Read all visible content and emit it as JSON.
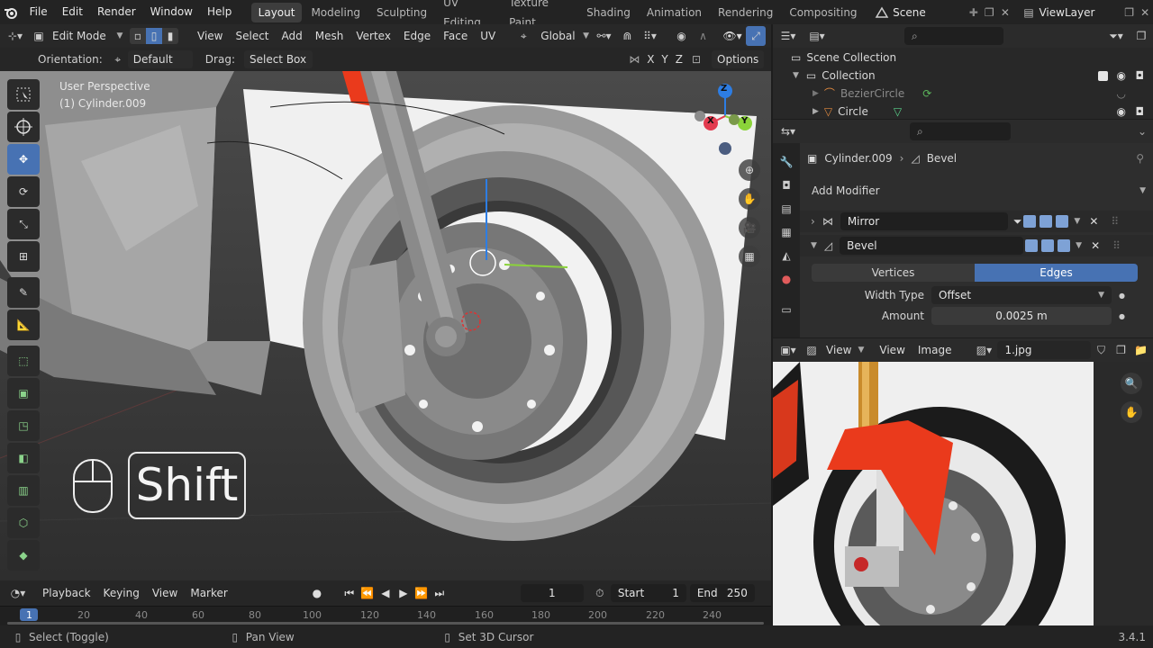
{
  "topbar": {
    "menus": [
      "File",
      "Edit",
      "Render",
      "Window",
      "Help"
    ],
    "workspaces": [
      "Layout",
      "Modeling",
      "Sculpting",
      "UV Editing",
      "Texture Paint",
      "Shading",
      "Animation",
      "Rendering",
      "Compositing"
    ],
    "active_workspace": "Layout",
    "scene": "Scene",
    "view_layer": "ViewLayer"
  },
  "viewport_header": {
    "mode": "Edit Mode",
    "menus": [
      "View",
      "Select",
      "Add",
      "Mesh",
      "Vertex",
      "Edge",
      "Face",
      "UV"
    ],
    "transform_orientation": "Global"
  },
  "tool_settings": {
    "orientation_label": "Orientation:",
    "orientation_value": "Default",
    "drag_label": "Drag:",
    "drag_value": "Select Box",
    "axes": [
      "X",
      "Y",
      "Z"
    ],
    "options_label": "Options"
  },
  "viewport": {
    "perspective": "User Perspective",
    "object": "(1) Cylinder.009",
    "gizmo_axes": {
      "z": "Z",
      "x": "X",
      "y": "Y"
    }
  },
  "key_overlay": {
    "key": "Shift",
    "mouse_icon": "mouse-icon"
  },
  "timeline": {
    "menus": [
      "Playback",
      "Keying",
      "View",
      "Marker"
    ],
    "current_frame": "1",
    "start_label": "Start",
    "start": "1",
    "end_label": "End",
    "end": "250",
    "ticks": [
      "1",
      "20",
      "40",
      "60",
      "80",
      "100",
      "120",
      "140",
      "160",
      "180",
      "200",
      "220",
      "240"
    ]
  },
  "statusbar": {
    "left": "Select (Toggle)",
    "middle": "Pan View",
    "right": "Set 3D Cursor",
    "version": "3.4.1"
  },
  "outliner": {
    "scene_collection": "Scene Collection",
    "collection": "Collection",
    "items": [
      "BezierCircle",
      "Circle"
    ]
  },
  "properties": {
    "breadcrumb_object": "Cylinder.009",
    "breadcrumb_modifier": "Bevel",
    "add_modifier": "Add Modifier",
    "modifiers": [
      {
        "name": "Mirror",
        "expanded": false
      },
      {
        "name": "Bevel",
        "expanded": true
      }
    ],
    "affect_options": [
      "Vertices",
      "Edges"
    ],
    "affect_selected": "Edges",
    "width_type_label": "Width Type",
    "width_type": "Offset",
    "amount_label": "Amount",
    "amount": "0.0025 m"
  },
  "image_editor": {
    "menus": [
      "View",
      "View",
      "Image"
    ],
    "image_name": "1.jpg"
  },
  "colors": {
    "accent": "#4772b3",
    "x_axis": "#e33b4f",
    "y_axis": "#8bd33a",
    "z_axis": "#2d7de3",
    "motorbike_red": "#ea3a1c"
  }
}
